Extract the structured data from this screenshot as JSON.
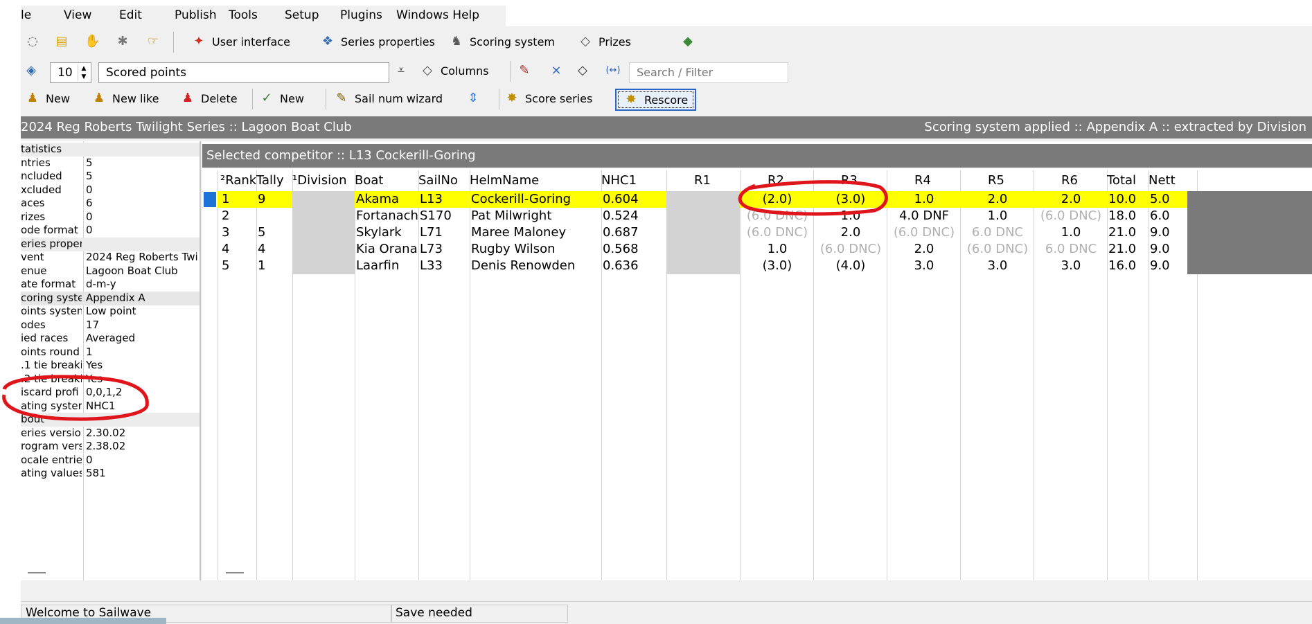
{
  "menu": [
    "le",
    "View",
    "Edit",
    "Publish",
    "Tools",
    "Setup",
    "Plugins",
    "Windows Help"
  ],
  "toolbar1": {
    "user_interface": "User interface",
    "series_properties": "Series properties",
    "scoring_system": "Scoring system",
    "prizes": "Prizes"
  },
  "toolbar2": {
    "rows_value": "10",
    "view_combo": "Scored points",
    "columns_label": "Columns",
    "search_placeholder": "Search / Filter"
  },
  "toolbar3": {
    "new": "New",
    "new_like": "New like",
    "delete": "Delete",
    "new2": "New",
    "sail_num_wizard": "Sail num wizard",
    "score_series": "Score series",
    "rescore": "Rescore"
  },
  "titlebar": {
    "left": "2024 Reg Roberts Twilight Series :: Lagoon Boat Club",
    "right": "Scoring system applied :: Appendix A :: extracted by Division"
  },
  "left_panel": [
    {
      "k": "tatistics",
      "v": "",
      "type": "sec"
    },
    {
      "k": "ntries",
      "v": "5"
    },
    {
      "k": "ncluded",
      "v": "5"
    },
    {
      "k": "xcluded",
      "v": "0"
    },
    {
      "k": "aces",
      "v": "6"
    },
    {
      "k": "rizes",
      "v": "0"
    },
    {
      "k": "ode format",
      "v": "0"
    },
    {
      "k": "eries proper",
      "v": "",
      "type": "sec"
    },
    {
      "k": "vent",
      "v": "2024 Reg Roberts Twi"
    },
    {
      "k": "enue",
      "v": "Lagoon Boat Club"
    },
    {
      "k": "ate format",
      "v": "d-m-y"
    },
    {
      "k": "coring syste",
      "v": "Appendix A",
      "type": "sel"
    },
    {
      "k": "oints systen",
      "v": "Low point"
    },
    {
      "k": "odes",
      "v": "17"
    },
    {
      "k": "ied races",
      "v": "Averaged"
    },
    {
      "k": "oints round",
      "v": "1"
    },
    {
      "k": ".1 tie breaki",
      "v": "Yes"
    },
    {
      "k": ".2 tie breaki",
      "v": "Yes"
    },
    {
      "k": "iscard profi",
      "v": "0,0,1,2"
    },
    {
      "k": "ating syster",
      "v": "NHC1"
    },
    {
      "k": "bout",
      "v": "",
      "type": "sec"
    },
    {
      "k": "eries versior",
      "v": "2.30.02"
    },
    {
      "k": "rogram vers",
      "v": "2.38.02"
    },
    {
      "k": "ocale entrie",
      "v": "0"
    },
    {
      "k": "ating values",
      "v": "581"
    }
  ],
  "selected_competitor": "Selected competitor :: L13 Cockerill-Goring",
  "columns": [
    "²Rank",
    "Tally",
    "¹Division",
    "Boat",
    "SailNo",
    "HelmName",
    "NHC1",
    "R1",
    "R2",
    "R3",
    "R4",
    "R5",
    "R6",
    "Total",
    "Nett"
  ],
  "rows": [
    {
      "rank": "1",
      "tally": "9",
      "boat": "Akama",
      "sail": "L13",
      "helm": "Cockerill-Goring",
      "nhc": "0.604",
      "r": [
        {
          "t": "(2.0)"
        },
        {
          "t": "(3.0)"
        },
        {
          "t": "1.0"
        },
        {
          "t": "2.0"
        },
        {
          "t": "2.0"
        }
      ],
      "total": "10.0",
      "nett": "5.0"
    },
    {
      "rank": "2",
      "tally": "",
      "boat": "Fortanach",
      "sail": "S170",
      "helm": "Pat Milwright",
      "nhc": "0.524",
      "r": [
        {
          "t": "(6.0 DNC)",
          "g": true
        },
        {
          "t": "1.0"
        },
        {
          "t": "4.0 DNF"
        },
        {
          "t": "1.0"
        },
        {
          "t": "(6.0 DNC)",
          "g": true
        }
      ],
      "total": "18.0",
      "nett": "6.0"
    },
    {
      "rank": "3",
      "tally": "5",
      "boat": "Skylark",
      "sail": "L71",
      "helm": "Maree Maloney",
      "nhc": "0.687",
      "r": [
        {
          "t": "(6.0 DNC)",
          "g": true
        },
        {
          "t": "2.0"
        },
        {
          "t": "(6.0 DNC)",
          "g": true
        },
        {
          "t": "6.0 DNC",
          "g": true
        },
        {
          "t": "1.0"
        }
      ],
      "total": "21.0",
      "nett": "9.0"
    },
    {
      "rank": "4",
      "tally": "4",
      "boat": "Kia Orana",
      "sail": "L73",
      "helm": "Rugby Wilson",
      "nhc": "0.568",
      "r": [
        {
          "t": "1.0"
        },
        {
          "t": "(6.0 DNC)",
          "g": true
        },
        {
          "t": "2.0"
        },
        {
          "t": "(6.0 DNC)",
          "g": true
        },
        {
          "t": "6.0 DNC",
          "g": true
        }
      ],
      "total": "21.0",
      "nett": "9.0"
    },
    {
      "rank": "5",
      "tally": "1",
      "boat": "Laarfin",
      "sail": "L33",
      "helm": "Denis Renowden",
      "nhc": "0.636",
      "r": [
        {
          "t": "(3.0)"
        },
        {
          "t": "(4.0)"
        },
        {
          "t": "3.0"
        },
        {
          "t": "3.0"
        },
        {
          "t": "3.0"
        }
      ],
      "total": "16.0",
      "nett": "9.0"
    }
  ],
  "status": {
    "left": "Welcome to Sailwave",
    "middle": "Save needed"
  },
  "colors": {
    "selected_row": "#ffff00",
    "titlebar": "#7a7a7a",
    "annotation": "#e0151b"
  },
  "icons": [
    "open-icon",
    "folder-icon",
    "hand-icon",
    "gear-icon",
    "user-interface-icon",
    "series-properties-icon",
    "scoring-system-icon",
    "prizes-icon",
    "help-icon",
    "columns-icon",
    "clear-icon",
    "score-series-icon",
    "rescore-icon"
  ]
}
